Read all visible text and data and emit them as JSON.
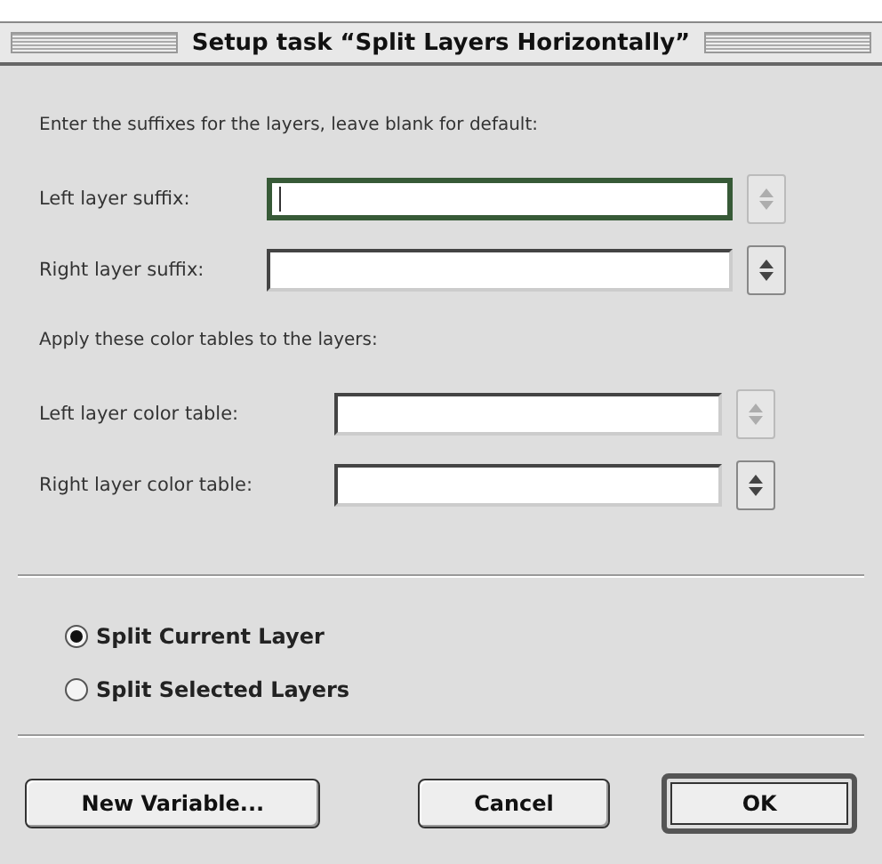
{
  "window": {
    "title": "Setup task “Split Layers Horizontally”"
  },
  "suffix_section": {
    "instruction": "Enter the suffixes for the layers, leave blank for default:",
    "fields": [
      {
        "label": "Left layer suffix:",
        "focused": true,
        "stepper_disabled": true
      },
      {
        "label": "Right layer suffix:",
        "focused": false,
        "stepper_disabled": false
      }
    ]
  },
  "color_section": {
    "instruction": "Apply these color tables to the layers:",
    "fields": [
      {
        "label": "Left layer color table:",
        "focused": false,
        "stepper_disabled": true
      },
      {
        "label": "Right layer color table:",
        "focused": false,
        "stepper_disabled": false
      }
    ]
  },
  "options": [
    {
      "label": "Split Current Layer",
      "selected": true
    },
    {
      "label": "Split Selected Layers",
      "selected": false
    }
  ],
  "buttons": [
    {
      "label": "New Variable...",
      "default": false
    },
    {
      "label": "Cancel",
      "default": false
    },
    {
      "label": "OK",
      "default": true
    }
  ]
}
